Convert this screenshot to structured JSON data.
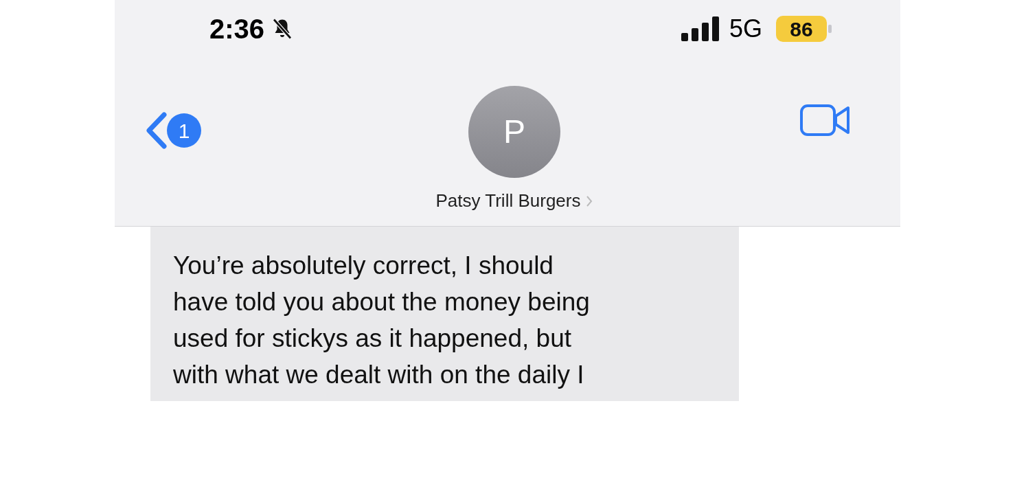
{
  "status_bar": {
    "time": "2:36",
    "silent": true,
    "network": "5G",
    "battery": "86",
    "low_power": true
  },
  "header": {
    "back_badge": "1",
    "avatar_initial": "P",
    "contact_name": "Patsy Trill Burgers"
  },
  "messages": [
    {
      "kind": "received",
      "lines": [
        "You’re absolutely correct, I should",
        "have told you about the money being",
        "used for stickys as it happened, but",
        "with what we dealt with on the daily I"
      ]
    }
  ]
}
